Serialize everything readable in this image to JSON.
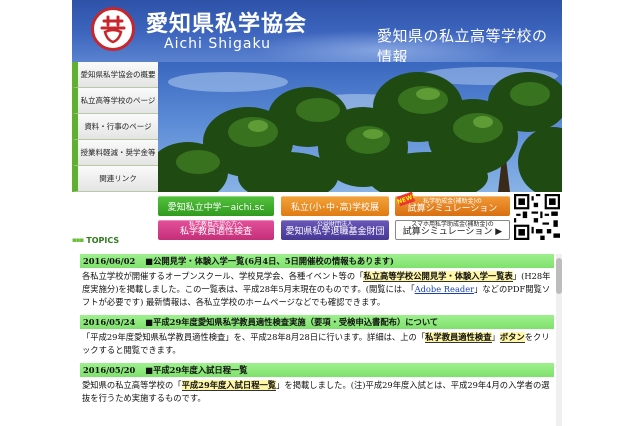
{
  "header": {
    "title": "愛知県私学協会",
    "subtitle": "Aichi Shigaku",
    "tagline": "愛知県の私立高等学校の情報"
  },
  "nav": {
    "items": [
      {
        "label": "愛知県私学協会の概要"
      },
      {
        "label": "私立高等学校のページ"
      },
      {
        "label": "資料・行事のページ"
      },
      {
        "label": "授業料軽減・奨学金等"
      },
      {
        "label": "関連リンク"
      }
    ]
  },
  "banners": {
    "aichi_sc": "愛知私立中学－aichi.sc",
    "school_fair": "私立(小･中･高)学校展",
    "subsidy_small": "私学助成金(補助金)の",
    "subsidy_main": "試算シミュレーション",
    "new_badge": "NEW!",
    "teacher_small": "私学教員志望の方へ",
    "teacher_main": "私学教員適性検査",
    "retire_small": "公益財団法人",
    "retire_main": "愛知県私学退職基金財団",
    "smartphone_small": "スマホ用私学助成金(補助金)の",
    "smartphone_main": "試算シミュレーション ▶"
  },
  "topics": {
    "heading": "TOPICS",
    "entries": [
      {
        "date": "2016/06/02",
        "title": "■公開見学・体験入学一覧(6月4日、5日開催校の情報もあります)",
        "body_pre": "各私立学校が開催するオープンスクール、学校見学会、各種イベント等の「",
        "body_link": "私立高等学校公開見学・体験入学一覧表",
        "body_mid": "」(H28年度実施分)を掲載しました。この一覧表は、平成28年5月末現在のものです。(閲覧には、「",
        "body_link2": "Adobe Reader",
        "body_post": "」などのPDF閲覧ソフトが必要です) 最新情報は、各私立学校のホームページなどでも確認できます。"
      },
      {
        "date": "2016/05/24",
        "title": "■平成29年度愛知県私学教員適性検査実施（要項・受検申込書配布）について",
        "body_pre": "「平成29年度愛知県私学教員適性検査」を、平成28年8月28日に行います。詳細は、上の「",
        "body_link": "私学教員適性検査",
        "body_mid": "」",
        "body_link2": "ボタン",
        "body_post": "をクリックすると閲覧できます。"
      },
      {
        "date": "2016/05/20",
        "title": "■平成29年度入試日程一覧",
        "body_pre": "愛知県の私立高等学校の「",
        "body_link": "平成29年度入試日程一覧",
        "body_mid": "」を掲載しました。(注)平成29年度入試とは、平成29年4月の入学者の選抜を行うため実施するものです。",
        "body_link2": "",
        "body_post": ""
      }
    ]
  },
  "colors": {
    "header_blue": "#3c64bd",
    "nav_green": "#5fb031",
    "topic_green": "#8fe97c",
    "link_blue": "#1a3fb0"
  }
}
